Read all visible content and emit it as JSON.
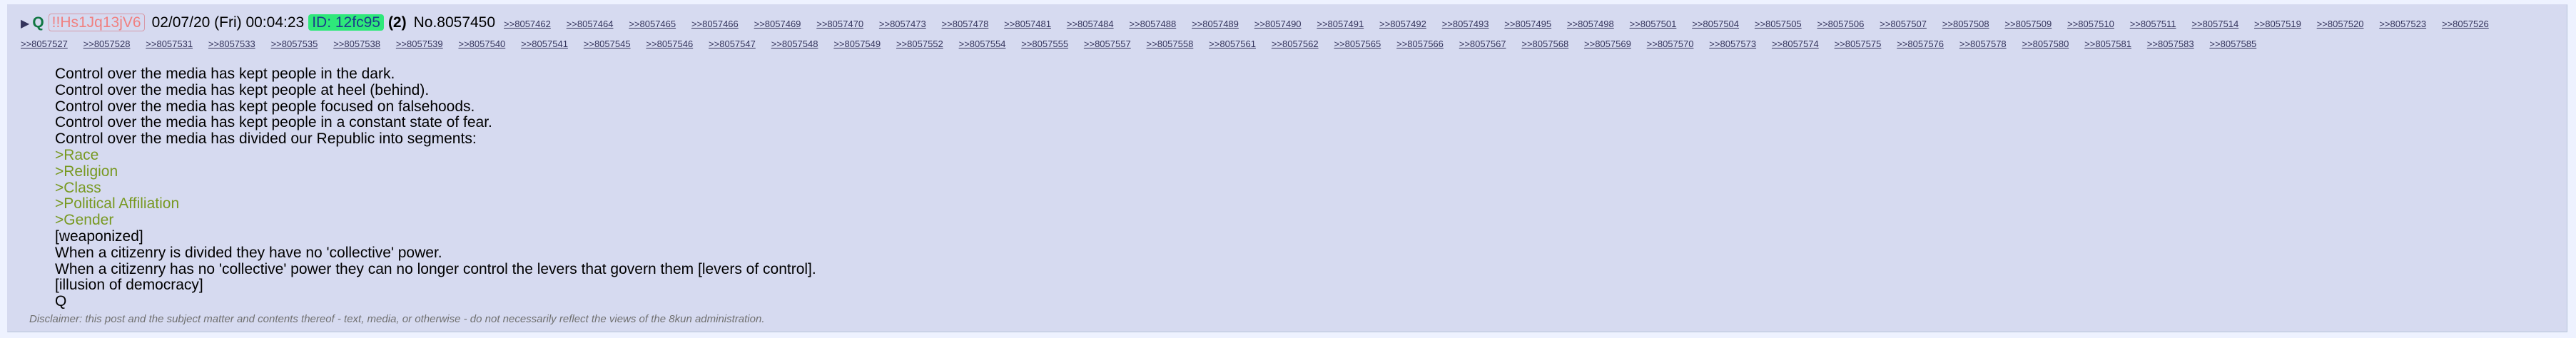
{
  "post": {
    "toggle_icon": "triangle-right-icon",
    "name": "Q",
    "tripcode": "!!Hs1Jq13jV6",
    "date": "02/07/20 (Fri) 00:04:23",
    "poster_id": "ID: 12fc95",
    "poster_post_count": "(2)",
    "post_number": "No.8057450",
    "backlinks": [
      ">>8057462",
      ">>8057464",
      ">>8057465",
      ">>8057466",
      ">>8057469",
      ">>8057470",
      ">>8057473",
      ">>8057478",
      ">>8057481",
      ">>8057484",
      ">>8057488",
      ">>8057489",
      ">>8057490",
      ">>8057491",
      ">>8057492",
      ">>8057493",
      ">>8057495",
      ">>8057498",
      ">>8057501",
      ">>8057504",
      ">>8057505",
      ">>8057506",
      ">>8057507",
      ">>8057508",
      ">>8057509",
      ">>8057510",
      ">>8057511",
      ">>8057514",
      ">>8057519",
      ">>8057520",
      ">>8057523",
      ">>8057526",
      ">>8057527",
      ">>8057528",
      ">>8057531",
      ">>8057533",
      ">>8057535",
      ">>8057538",
      ">>8057539",
      ">>8057540",
      ">>8057541",
      ">>8057545",
      ">>8057546",
      ">>8057547",
      ">>8057548",
      ">>8057549",
      ">>8057552",
      ">>8057554",
      ">>8057555",
      ">>8057557",
      ">>8057558",
      ">>8057561",
      ">>8057562",
      ">>8057565",
      ">>8057566",
      ">>8057567",
      ">>8057568",
      ">>8057569",
      ">>8057570",
      ">>8057573",
      ">>8057574",
      ">>8057575",
      ">>8057576",
      ">>8057578",
      ">>8057580",
      ">>8057581",
      ">>8057583",
      ">>8057585"
    ],
    "body_lines": [
      {
        "text": "Control over the media has kept people in the dark.",
        "greentext": false
      },
      {
        "text": "Control over the media has kept people at heel (behind).",
        "greentext": false
      },
      {
        "text": "Control over the media has kept people focused on falsehoods.",
        "greentext": false
      },
      {
        "text": "Control over the media has kept people in a constant state of fear.",
        "greentext": false
      },
      {
        "text": "Control over the media has divided our Republic into segments:",
        "greentext": false
      },
      {
        "text": ">Race",
        "greentext": true
      },
      {
        "text": ">Religion",
        "greentext": true
      },
      {
        "text": ">Class",
        "greentext": true
      },
      {
        "text": ">Political Affiliation",
        "greentext": true
      },
      {
        "text": ">Gender",
        "greentext": true
      },
      {
        "text": "[weaponized]",
        "greentext": false
      },
      {
        "text": "When a citizenry is divided they have no 'collective' power.",
        "greentext": false
      },
      {
        "text": "When a citizenry has no 'collective' power they can no longer control the levers that govern them [levers of control].",
        "greentext": false
      },
      {
        "text": "[illusion of democracy]",
        "greentext": false
      },
      {
        "text": "Q",
        "greentext": false
      }
    ],
    "disclaimer": "Disclaimer: this post and the subject matter and contents thereof - text, media, or otherwise - do not necessarily reflect the views of the 8kun administration."
  },
  "colors": {
    "post_background": "#d6daf0",
    "page_background": "#eef2ff",
    "name": "#117743",
    "tripcode": "#f08080",
    "id_highlight": "#2ee87a",
    "greentext": "#789922",
    "link": "#34345c",
    "disclaimer": "#707070"
  }
}
